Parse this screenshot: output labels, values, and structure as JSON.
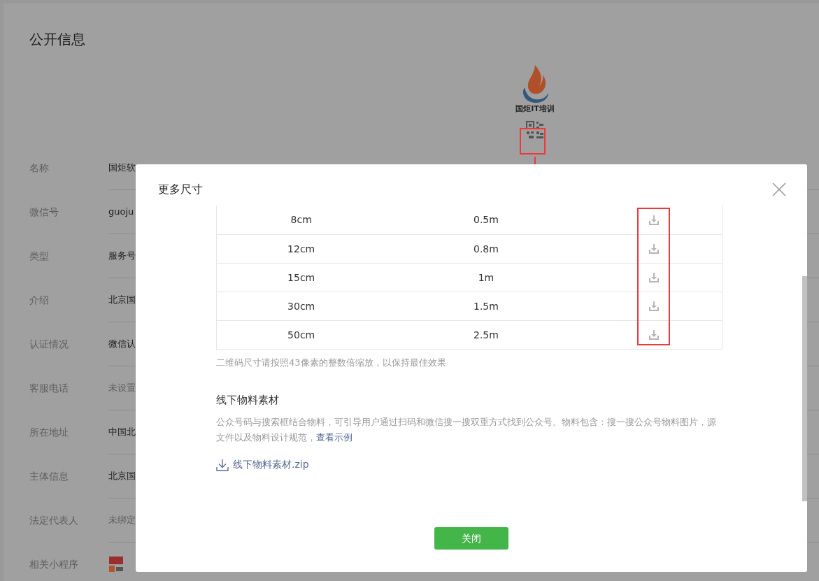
{
  "page": {
    "title": "公开信息",
    "logo_text": "国炬IT培训",
    "rows": [
      {
        "kind": "text",
        "label": "名称",
        "value": "国炬软",
        "muted": false
      },
      {
        "kind": "text",
        "label": "微信号",
        "value": "guoju",
        "muted": false
      },
      {
        "kind": "text",
        "label": "类型",
        "value": "服务号",
        "muted": false
      },
      {
        "kind": "text",
        "label": "介绍",
        "value": "北京国",
        "muted": false
      },
      {
        "kind": "text",
        "label": "认证情况",
        "value": "微信认",
        "muted": false
      },
      {
        "kind": "text",
        "label": "客服电话",
        "value": "未设置",
        "muted": true
      },
      {
        "kind": "text",
        "label": "所在地址",
        "value": "中国北",
        "muted": false
      },
      {
        "kind": "text",
        "label": "主体信息",
        "value": "北京国",
        "muted": false
      },
      {
        "kind": "text",
        "label": "法定代表人",
        "value": "未绑定",
        "muted": true
      },
      {
        "kind": "mini_program",
        "label": "相关小程序"
      }
    ]
  },
  "dialog": {
    "title": "更多尺寸",
    "table": {
      "rows": [
        {
          "size": "8cm",
          "distance": "0.5m"
        },
        {
          "size": "12cm",
          "distance": "0.8m"
        },
        {
          "size": "15cm",
          "distance": "1m"
        },
        {
          "size": "30cm",
          "distance": "1.5m"
        },
        {
          "size": "50cm",
          "distance": "2.5m"
        }
      ]
    },
    "note": "二维码尺寸请按照43像素的整数倍缩放，以保持最佳效果",
    "section": {
      "title": "线下物料素材",
      "description": "公众号码与搜索框结合物料，可引导用户通过扫码和微信搜一搜双重方式找到公众号。物料包含：搜一搜公众号物料图片，源文件以及物料设计规范，",
      "link": "查看示例",
      "file": "线下物料素材.zip"
    },
    "close_button": "关闭"
  }
}
